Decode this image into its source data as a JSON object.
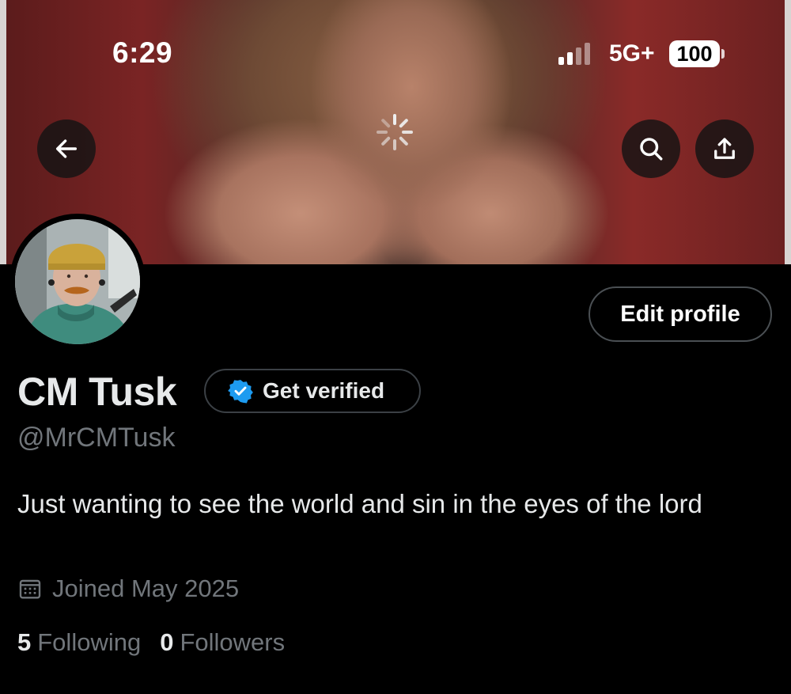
{
  "status_bar": {
    "time": "6:29",
    "network": "5G+",
    "battery": "100",
    "signal_bars_filled": 2,
    "signal_bars_total": 4
  },
  "header": {
    "back_icon": "arrow-left-icon",
    "search_icon": "search-icon",
    "share_icon": "share-icon",
    "loading_icon": "spinner-icon"
  },
  "profile": {
    "edit_button_label": "Edit profile",
    "display_name": "CM Tusk",
    "get_verified_label": "Get verified",
    "verified_badge_color": "#1d9bf0",
    "handle": "@MrCMTusk",
    "bio": "Just wanting to see the world and sin in the eyes of the lord",
    "joined": "Joined May 2025",
    "following_count": "5",
    "following_label": "Following",
    "followers_count": "0",
    "followers_label": "Followers"
  },
  "colors": {
    "background": "#000000",
    "primary_text": "#e7e9ea",
    "secondary_text": "#71767b",
    "border": "#4a4f53",
    "accent": "#1d9bf0"
  }
}
